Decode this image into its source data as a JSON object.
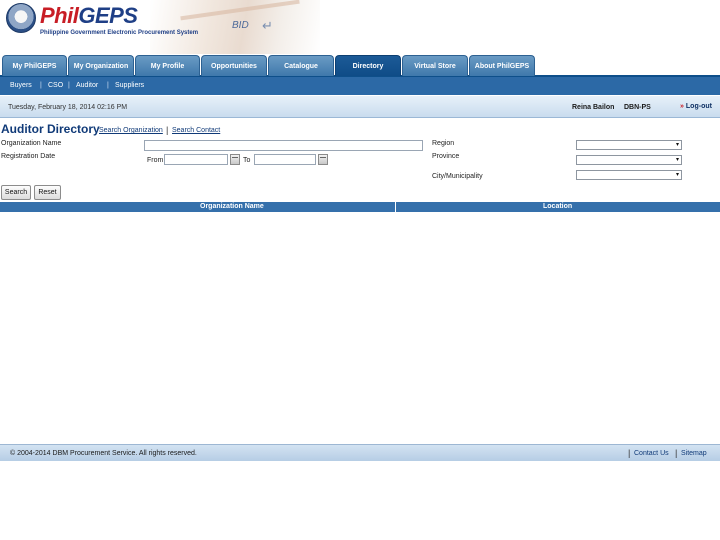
{
  "header": {
    "logo_phil": "Phil",
    "logo_geps": "GEPS",
    "logo_subtitle": "Philippine Government Electronic Procurement System",
    "bid_text": "BID",
    "bid_arrow": "↵"
  },
  "tabs": [
    {
      "label": "My PhilGEPS"
    },
    {
      "label": "My Organization"
    },
    {
      "label": "My Profile"
    },
    {
      "label": "Opportunities"
    },
    {
      "label": "Catalogue"
    },
    {
      "label": "Directory",
      "active": true
    },
    {
      "label": "Virtual Store"
    },
    {
      "label": "About PhilGEPS"
    }
  ],
  "subnav": {
    "items": [
      "Buyers",
      "CSO",
      "Auditor",
      "Suppliers"
    ],
    "separator": "|"
  },
  "infobar": {
    "datetime": "Tuesday, February 18, 2014 02:16 PM",
    "user_name": "Reina Bailon",
    "user_code": "DBN-PS",
    "logout_chevron": "»",
    "logout_label": "Log-out"
  },
  "page": {
    "title": "Auditor Directory",
    "link_search_org": "Search Organization",
    "link_separator": "|",
    "link_search_contact": "Search Contact"
  },
  "form": {
    "org_name_label": "Organization Name",
    "org_name_value": "",
    "reg_date_label": "Registration Date",
    "from_label": "From",
    "to_label": "To",
    "from_value": "",
    "to_value": "",
    "region_label": "Region",
    "province_label": "Province",
    "city_label": "City/Municipality",
    "region_value": "",
    "province_value": "",
    "city_value": "",
    "dropdown_arrow": "▾",
    "search_button": "Search",
    "reset_button": "Reset"
  },
  "results": {
    "col_org_name": "Organization Name",
    "col_location": "Location"
  },
  "footer": {
    "copyright": "© 2004-2014  DBM Procurement Service. All rights reserved.",
    "separator": "|",
    "contact_us": "Contact Us",
    "sitemap": "Sitemap"
  },
  "colors": {
    "brand_blue": "#103a78",
    "brand_red": "#c81d25",
    "tab_active": "#0f4c87",
    "subnav": "#2c69a6",
    "grid_header": "#3570ab"
  }
}
